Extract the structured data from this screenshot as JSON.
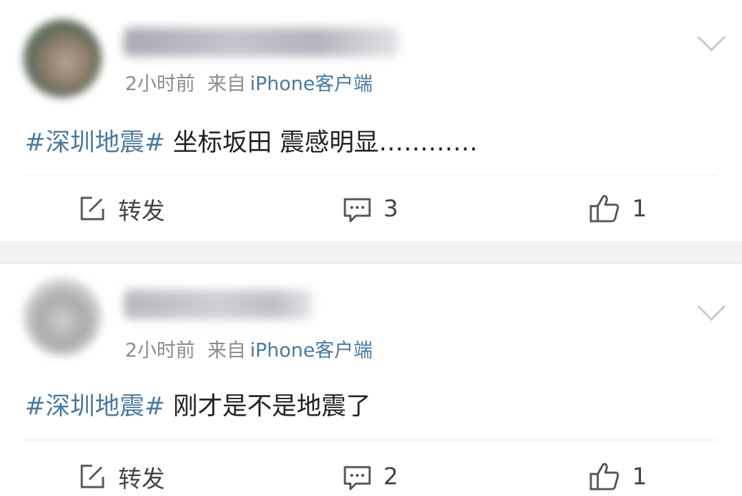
{
  "posts": [
    {
      "time": "2小时前",
      "from_label": "来自",
      "source": "iPhone客户端",
      "hashtag": "#深圳地震#",
      "text": " 坐标坂田 震感明显…………",
      "repost_label": "转发",
      "comment_count": "3",
      "like_count": "1"
    },
    {
      "time": "2小时前",
      "from_label": "来自",
      "source": "iPhone客户端",
      "hashtag": "#深圳地震#",
      "text": " 刚才是不是地震了",
      "repost_label": "转发",
      "comment_count": "2",
      "like_count": "1"
    }
  ],
  "icons": {
    "repost": "edit-square-icon",
    "comment": "comment-bubble-icon",
    "like": "thumbs-up-icon",
    "more": "chevron-down-icon"
  },
  "colors": {
    "link": "#4a7aa0",
    "meta": "#8c8c8c",
    "text": "#222222"
  }
}
